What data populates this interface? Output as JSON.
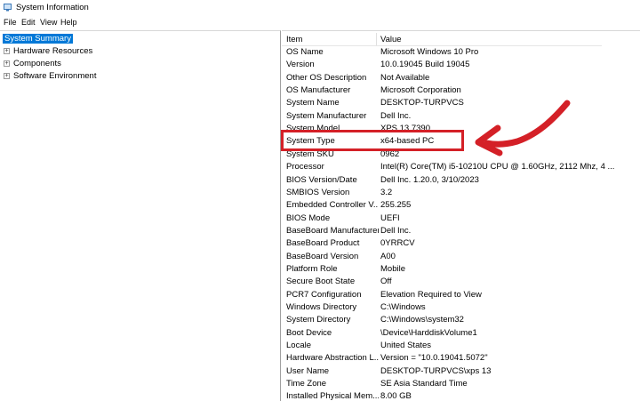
{
  "window": {
    "title": "System Information",
    "icon": "system-info-icon"
  },
  "menu": [
    "File",
    "Edit",
    "View",
    "Help"
  ],
  "tree": [
    {
      "label": "System Summary",
      "selected": true,
      "expandable": false
    },
    {
      "label": "Hardware Resources",
      "selected": false,
      "expandable": true
    },
    {
      "label": "Components",
      "selected": false,
      "expandable": true
    },
    {
      "label": "Software Environment",
      "selected": false,
      "expandable": true
    }
  ],
  "table": {
    "headers": [
      "Item",
      "Value"
    ],
    "rows": [
      [
        "OS Name",
        "Microsoft Windows 10 Pro"
      ],
      [
        "Version",
        "10.0.19045 Build 19045"
      ],
      [
        "Other OS Description",
        "Not Available"
      ],
      [
        "OS Manufacturer",
        "Microsoft Corporation"
      ],
      [
        "System Name",
        "DESKTOP-TURPVCS"
      ],
      [
        "System Manufacturer",
        "Dell Inc."
      ],
      [
        "System Model",
        "XPS 13 7390"
      ],
      [
        "System Type",
        "x64-based PC"
      ],
      [
        "System SKU",
        "0962"
      ],
      [
        "Processor",
        "Intel(R) Core(TM) i5-10210U CPU @ 1.60GHz, 2112 Mhz, 4 ..."
      ],
      [
        "BIOS Version/Date",
        "Dell Inc. 1.20.0, 3/10/2023"
      ],
      [
        "SMBIOS Version",
        "3.2"
      ],
      [
        "Embedded Controller V...",
        "255.255"
      ],
      [
        "BIOS Mode",
        "UEFI"
      ],
      [
        "BaseBoard Manufacturer",
        "Dell Inc."
      ],
      [
        "BaseBoard Product",
        "0YRRCV"
      ],
      [
        "BaseBoard Version",
        "A00"
      ],
      [
        "Platform Role",
        "Mobile"
      ],
      [
        "Secure Boot State",
        "Off"
      ],
      [
        "PCR7 Configuration",
        "Elevation Required to View"
      ],
      [
        "Windows Directory",
        "C:\\Windows"
      ],
      [
        "System Directory",
        "C:\\Windows\\system32"
      ],
      [
        "Boot Device",
        "\\Device\\HarddiskVolume1"
      ],
      [
        "Locale",
        "United States"
      ],
      [
        "Hardware Abstraction L...",
        "Version = \"10.0.19041.5072\""
      ],
      [
        "User Name",
        "DESKTOP-TURPVCS\\xps 13"
      ],
      [
        "Time Zone",
        "SE Asia Standard Time"
      ],
      [
        "Installed Physical Mem...",
        "8.00 GB"
      ]
    ]
  },
  "annotation": {
    "highlighted_row": "System Type",
    "color": "#d42027"
  }
}
